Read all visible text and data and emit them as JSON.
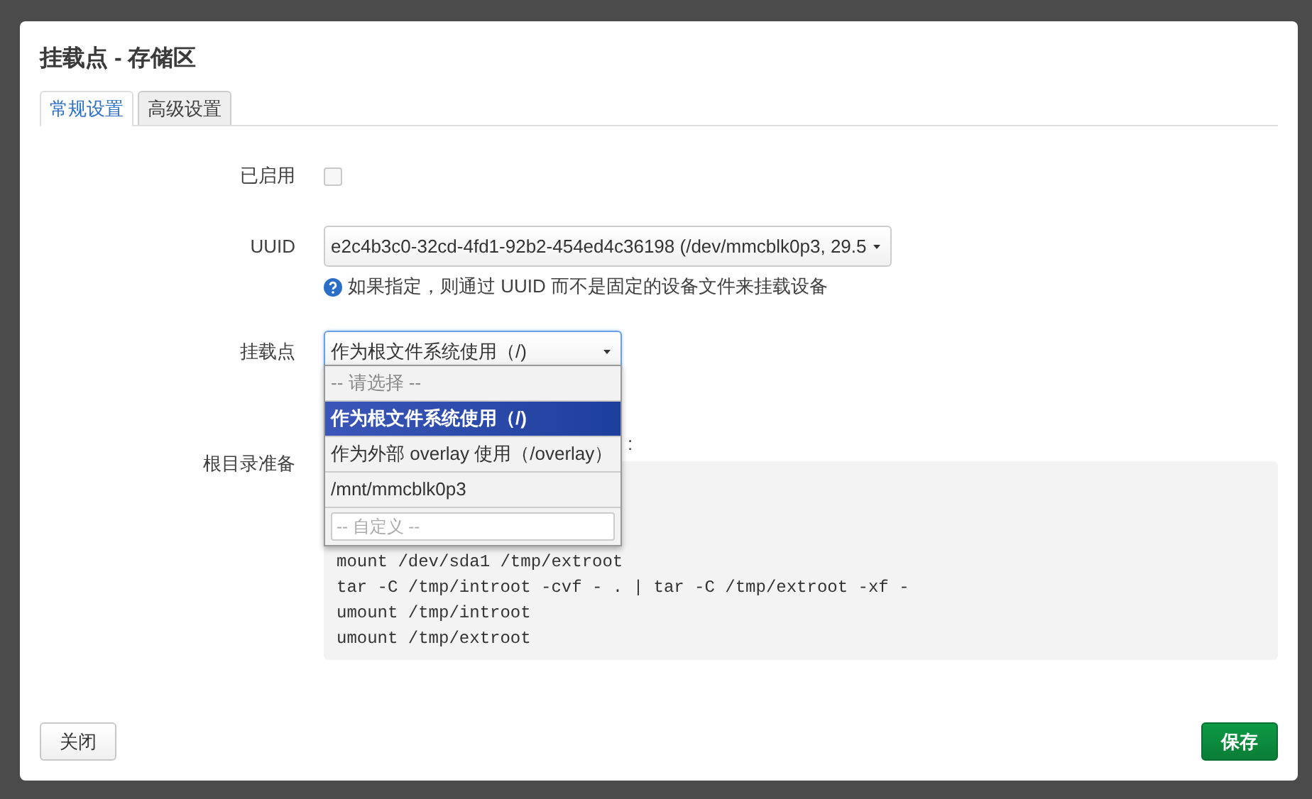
{
  "dialog": {
    "title": "挂载点 - 存储区",
    "tabs": [
      {
        "label": "常规设置",
        "selected": true
      },
      {
        "label": "高级设置",
        "selected": false
      }
    ],
    "enabled": {
      "label": "已启用",
      "checked": false
    },
    "uuid": {
      "label": "UUID",
      "value": "e2c4b3c0-32cd-4fd1-92b2-454ed4c36198 (/dev/mmcblk0p3, 29.5",
      "help": "如果指定，则通过 UUID 而不是固定的设备文件来挂载设备"
    },
    "mount_point": {
      "label": "挂载点",
      "value": "作为根文件系统使用（/)",
      "expanded": true,
      "options": [
        {
          "kind": "placeholder",
          "label": "-- 请选择 --",
          "selected": false
        },
        {
          "kind": "option",
          "label": "作为根文件系统使用（/)",
          "selected": true
        },
        {
          "kind": "option",
          "label": "作为外部 overlay 使用（/overlay）",
          "selected": false
        },
        {
          "kind": "option",
          "label": "/mnt/mmcblk0p3",
          "selected": false
        },
        {
          "kind": "custom",
          "placeholder": "-- 自定义 --",
          "selected": false
        }
      ]
    },
    "root_prep": {
      "label": "根目录准备",
      "note_tail": ":",
      "code": [
        "mount /dev/sda1 /tmp/extroot",
        "tar -C /tmp/introot -cvf - . | tar -C /tmp/extroot -xf -",
        "umount /tmp/introot",
        "umount /tmp/extroot"
      ]
    },
    "buttons": [
      {
        "kind": "close",
        "label": "关闭"
      },
      {
        "kind": "save",
        "label": "保存"
      }
    ]
  }
}
